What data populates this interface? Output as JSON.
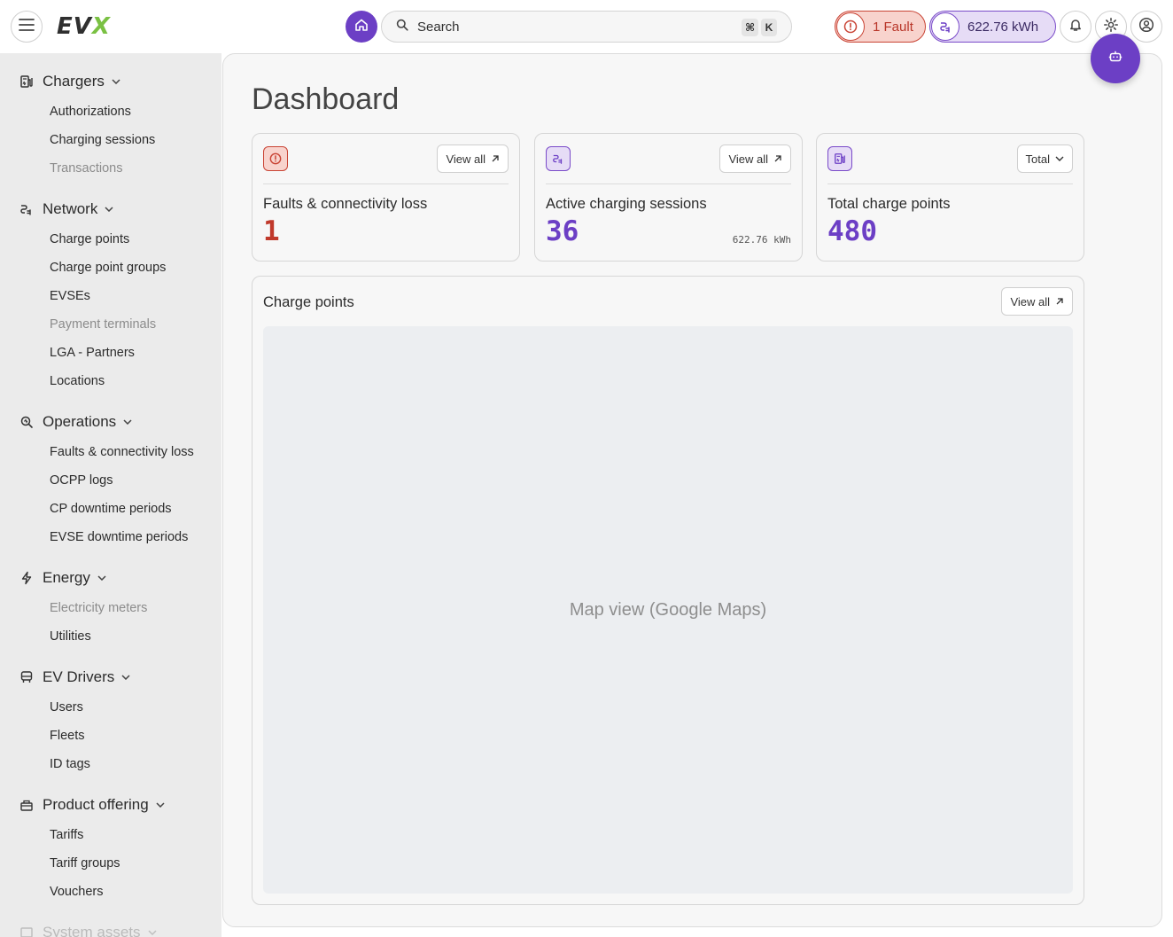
{
  "app": {
    "logo_ev": "EV",
    "logo_x": "X",
    "brand_color": "#6c3fc5",
    "accent_green": "#7ac143"
  },
  "header": {
    "search": {
      "label": "Search",
      "shortcut_cmd": "⌘",
      "shortcut_key": "K"
    },
    "fault_pill": {
      "label": "1 Fault",
      "color": "#c94435"
    },
    "energy_pill": {
      "label": "622.76 kWh",
      "color": "#7a4bc9"
    },
    "icons": [
      "menu-icon",
      "home-icon",
      "search-icon",
      "bell-icon",
      "gear-icon",
      "user-circle-icon",
      "robot-icon"
    ]
  },
  "sidebar": {
    "sections": [
      {
        "title": "Chargers",
        "icon": "charger-icon",
        "items": [
          {
            "label": "Authorizations",
            "muted": false
          },
          {
            "label": "Charging sessions",
            "muted": false
          },
          {
            "label": "Transactions",
            "muted": true
          }
        ]
      },
      {
        "title": "Network",
        "icon": "network-icon",
        "items": [
          {
            "label": "Charge points",
            "muted": false
          },
          {
            "label": "Charge point groups",
            "muted": false
          },
          {
            "label": "EVSEs",
            "muted": false
          },
          {
            "label": "Payment terminals",
            "muted": true
          },
          {
            "label": "LGA - Partners",
            "muted": false
          },
          {
            "label": "Locations",
            "muted": false
          }
        ]
      },
      {
        "title": "Operations",
        "icon": "operations-icon",
        "items": [
          {
            "label": "Faults & connectivity loss",
            "muted": false
          },
          {
            "label": "OCPP logs",
            "muted": false
          },
          {
            "label": "CP downtime periods",
            "muted": false
          },
          {
            "label": "EVSE downtime periods",
            "muted": false
          }
        ]
      },
      {
        "title": "Energy",
        "icon": "bolt-icon",
        "items": [
          {
            "label": "Electricity meters",
            "muted": true
          },
          {
            "label": "Utilities",
            "muted": false
          }
        ]
      },
      {
        "title": "EV Drivers",
        "icon": "car-icon",
        "items": [
          {
            "label": "Users",
            "muted": false
          },
          {
            "label": "Fleets",
            "muted": false
          },
          {
            "label": "ID tags",
            "muted": false
          }
        ]
      },
      {
        "title": "Product offering",
        "icon": "gift-icon",
        "items": [
          {
            "label": "Tariffs",
            "muted": false
          },
          {
            "label": "Tariff groups",
            "muted": false
          },
          {
            "label": "Vouchers",
            "muted": false
          }
        ]
      },
      {
        "title": "System assets",
        "icon": "assets-icon",
        "items": []
      }
    ]
  },
  "main": {
    "title": "Dashboard",
    "cards": [
      {
        "title": "Faults & connectivity loss",
        "value": "1",
        "sub": "",
        "button": "View all",
        "value_color": "#c0392b"
      },
      {
        "title": "Active charging sessions",
        "value": "36",
        "sub": "622.76 kWh",
        "button": "View all",
        "value_color": "#6c3fc5"
      },
      {
        "title": "Total charge points",
        "value": "480",
        "sub": "",
        "button": "Total",
        "value_color": "#6c3fc5"
      }
    ],
    "map": {
      "title": "Charge points",
      "button": "View all",
      "placeholder": "Map view (Google Maps)"
    }
  }
}
